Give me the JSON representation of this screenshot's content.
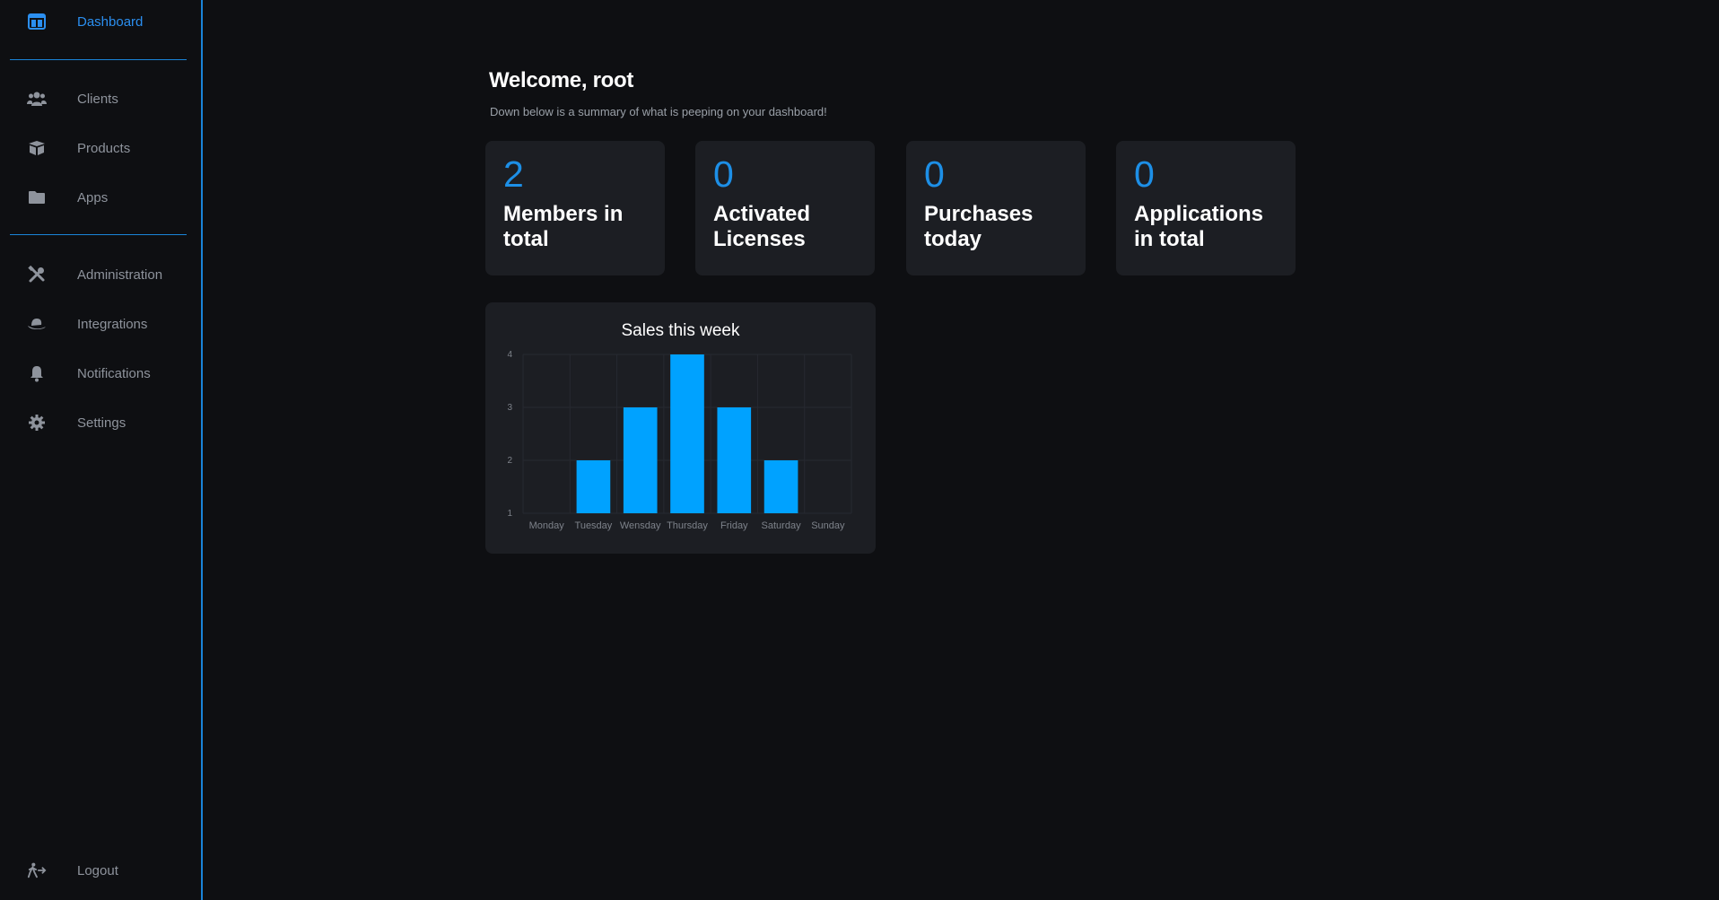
{
  "sidebar": {
    "items": [
      {
        "label": "Dashboard",
        "icon": "dashboard-icon",
        "active": true
      },
      {
        "label": "Clients",
        "icon": "users-icon"
      },
      {
        "label": "Products",
        "icon": "box-icon"
      },
      {
        "label": "Apps",
        "icon": "folder-icon"
      },
      {
        "label": "Administration",
        "icon": "tools-icon"
      },
      {
        "label": "Integrations",
        "icon": "hat-icon"
      },
      {
        "label": "Notifications",
        "icon": "bell-icon"
      },
      {
        "label": "Settings",
        "icon": "gear-icon"
      },
      {
        "label": "Logout",
        "icon": "logout-icon"
      }
    ]
  },
  "colors": {
    "accent": "#1d8fe6",
    "bar": "#00a2ff",
    "card": "#1c1e23",
    "background": "#0e0f12"
  },
  "main": {
    "title": "Welcome, root",
    "subtitle": "Down below is a summary of what is peeping on your dashboard!",
    "stats": [
      {
        "value": "2",
        "label": "Members in total"
      },
      {
        "value": "0",
        "label": "Activated Licenses"
      },
      {
        "value": "0",
        "label": "Purchases today"
      },
      {
        "value": "0",
        "label": "Applications in total"
      }
    ]
  },
  "chart_data": {
    "type": "bar",
    "title": "Sales this week",
    "categories": [
      "Monday",
      "Tuesday",
      "Wensday",
      "Thursday",
      "Friday",
      "Saturday",
      "Sunday"
    ],
    "values": [
      1,
      2,
      3,
      4,
      3,
      2,
      1
    ],
    "yticks": [
      "1",
      "2",
      "3",
      "4"
    ],
    "ylim": [
      1,
      4
    ],
    "grid": true,
    "xlabel": "",
    "ylabel": ""
  }
}
